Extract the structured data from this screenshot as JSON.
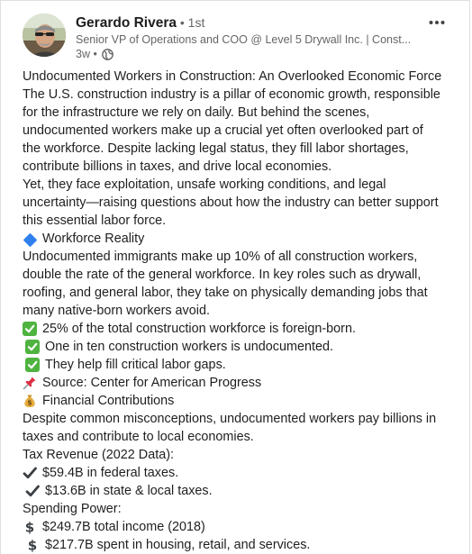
{
  "post": {
    "author": {
      "name": "Gerardo Rivera",
      "degree": " • 1st",
      "headline": "Senior VP of Operations and COO @ Level 5 Drywall Inc. | Const...",
      "time": "3w •"
    },
    "icons": {
      "more": "more-horizontal-icon",
      "visibility": "globe-icon",
      "check": "white-check-mark-emoji",
      "diamond": "blue-diamond-emoji",
      "pin": "pushpin-emoji",
      "money": "money-bag-emoji",
      "checkmark": "heavy-check-mark-emoji",
      "dollar": "heavy-dollar-sign-emoji"
    },
    "lines": [
      "Undocumented Workers in Construction: An Overlooked Economic Force",
      "The U.S. construction industry is a pillar of economic growth, responsible",
      "for the infrastructure we rely on daily. But behind the scenes,",
      "undocumented workers make up a crucial yet often overlooked part of",
      "the workforce. Despite lacking legal status, they fill labor shortages,",
      "contribute billions in taxes, and drive local economies.",
      "Yet, they face exploitation, unsafe working conditions, and legal",
      "uncertainty—raising questions about how the industry can better support",
      "this essential labor force.",
      "Workforce Reality",
      "Undocumented immigrants make up 10% of all construction workers,",
      "double the rate of the general workforce. In key roles such as drywall,",
      "roofing, and general labor, they take on physically demanding jobs that",
      "many native-born workers avoid.",
      "25% of the total construction workforce is foreign-born.",
      "One in ten construction workers is undocumented.",
      "They help fill critical labor gaps.",
      "Source: Center for American Progress",
      "Financial Contributions",
      "Despite common misconceptions, undocumented workers pay billions in",
      "taxes and contribute to local economies.",
      "Tax Revenue (2022 Data):",
      "$59.4B in federal taxes.",
      "$13.6B in state & local taxes.",
      "Spending Power:",
      "$249.7B total income (2018)",
      "$217.7B spent in housing, retail, and services."
    ]
  }
}
